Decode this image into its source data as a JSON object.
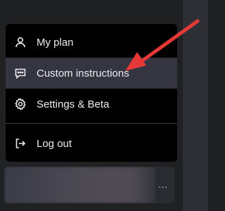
{
  "menu": {
    "items": [
      {
        "label": "My plan",
        "icon": "user-icon"
      },
      {
        "label": "Custom instructions",
        "icon": "chat-dots-icon",
        "active": true
      },
      {
        "label": "Settings & Beta",
        "icon": "gear-icon"
      },
      {
        "label": "Log out",
        "icon": "logout-icon"
      }
    ]
  },
  "user": {
    "more_icon": "…"
  },
  "colors": {
    "menu_bg": "#000000",
    "active_bg": "#343541",
    "text": "#ececf1",
    "arrow": "#e53935"
  }
}
